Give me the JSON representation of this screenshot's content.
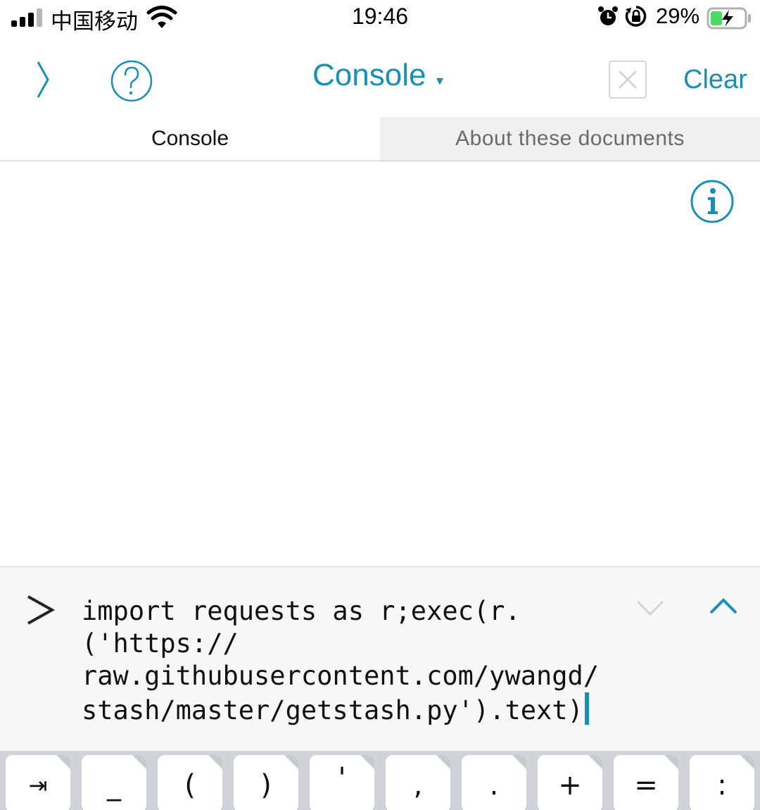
{
  "status_bar": {
    "carrier": "中国移动",
    "time": "19:46",
    "battery_percent": "29%",
    "icons": [
      "signal-icon",
      "wifi-icon",
      "alarm-icon",
      "rotation-lock-icon",
      "battery-charging-icon"
    ]
  },
  "toolbar": {
    "title": "Console",
    "caret": "▾",
    "clear_label": "Clear",
    "icons": [
      "chevron-right-icon",
      "help-icon",
      "close-icon"
    ]
  },
  "tabs": [
    {
      "label": "Console",
      "active": true
    },
    {
      "label": "About these documents",
      "active": false
    }
  ],
  "input": {
    "prompt": ">",
    "code": "import requests as r;exec(r.\n('https://\nraw.githubusercontent.com/ywangd/\nstash/master/getstash.py').text)"
  },
  "keyboard": {
    "keys": [
      "⇥",
      "_",
      "(",
      ")",
      "'",
      ",",
      ".",
      "+",
      "=",
      ":"
    ]
  },
  "colors": {
    "accent": "#1a8fb6",
    "tab_inactive_bg": "#efefef",
    "keyboard_bg": "#d1d3d9"
  }
}
